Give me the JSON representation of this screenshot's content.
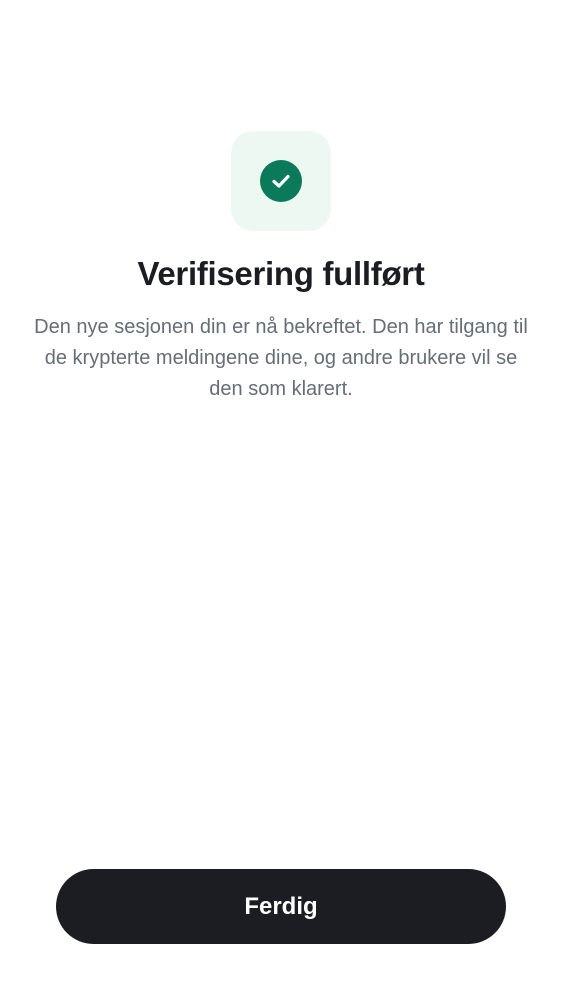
{
  "header": {
    "status_icon": "check-circle-icon",
    "title": "Verifisering fullført",
    "description": "Den nye sesjonen din er nå bekreftet. Den har tilgang til de krypterte meldingene dine, og andre brukere vil se den som klarert."
  },
  "footer": {
    "done_label": "Ferdig"
  },
  "colors": {
    "accent": "#0a7a5a",
    "tile_background": "#eef8f3",
    "button_background": "#1b1d22",
    "text_primary": "#1b1d22",
    "text_secondary": "#656d77"
  }
}
